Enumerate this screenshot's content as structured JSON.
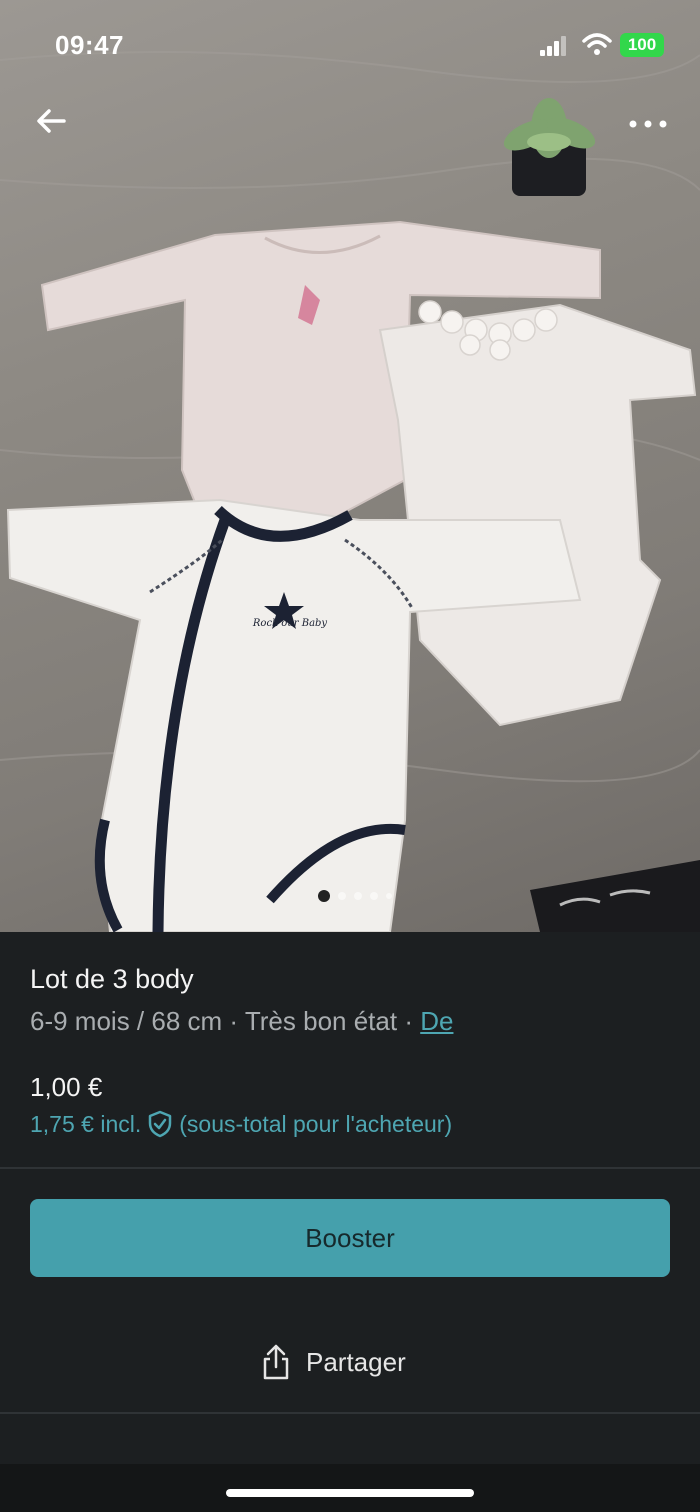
{
  "status_bar": {
    "time": "09:47",
    "battery": "100"
  },
  "listing": {
    "title": "Lot de 3 body",
    "size": "6-9 mois / 68 cm",
    "separator": "·",
    "condition": "Très bon état",
    "brand_link": "De",
    "price": "1,00 €",
    "price_incl": "1,75 € incl.",
    "price_note": "(sous-total pour l'acheteur)"
  },
  "photo": {
    "print_text": "Rock our Baby",
    "carousel_pages": 5,
    "carousel_active": 1
  },
  "actions": {
    "booster_label": "Booster",
    "share_label": "Partager"
  },
  "colors": {
    "accent": "#45a0ac",
    "link": "#4ea6b2",
    "background": "#1c1f21",
    "battery": "#32d74b"
  },
  "icons": {
    "back": "arrow-left-icon",
    "more": "more-dots-icon",
    "shield": "shield-check-icon",
    "share": "share-icon"
  }
}
